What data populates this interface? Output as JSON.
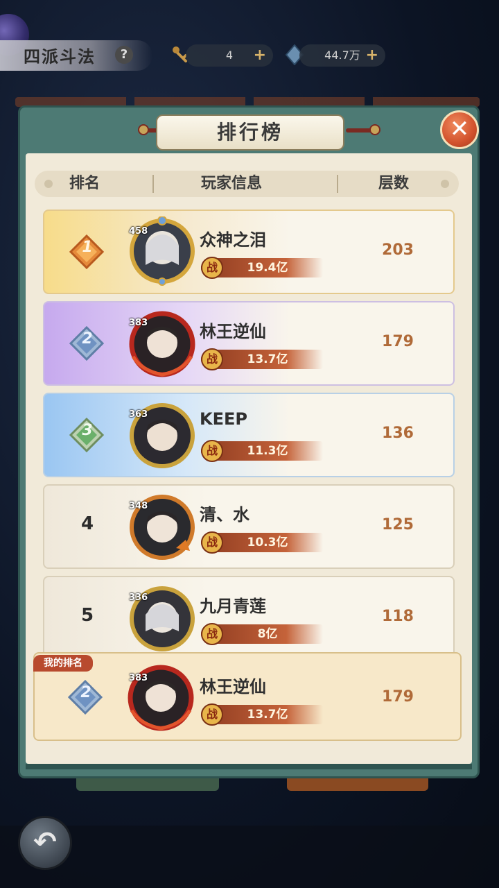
{
  "top": {
    "mode_title": "四派斗法",
    "help": "?",
    "resource1": {
      "value": "4",
      "plus": "+"
    },
    "resource2": {
      "value": "44.7万",
      "plus": "+"
    }
  },
  "panel": {
    "title": "排行榜",
    "close": "✕",
    "headers": {
      "rank": "排名",
      "player": "玩家信息",
      "floor": "层数"
    }
  },
  "rows": [
    {
      "rank": "1",
      "level": "458",
      "name": "众神之泪",
      "power_icon": "战",
      "power": "19.4亿",
      "floor": "203"
    },
    {
      "rank": "2",
      "level": "383",
      "name": "林王逆仙",
      "power_icon": "战",
      "power": "13.7亿",
      "floor": "179"
    },
    {
      "rank": "3",
      "level": "363",
      "name": "KEEP",
      "power_icon": "战",
      "power": "11.3亿",
      "floor": "136"
    },
    {
      "rank": "4",
      "level": "348",
      "name": "清、水",
      "power_icon": "战",
      "power": "10.3亿",
      "floor": "125"
    },
    {
      "rank": "5",
      "level": "336",
      "name": "九月青莲",
      "power_icon": "战",
      "power": "8亿",
      "floor": "118"
    }
  ],
  "my_rank": {
    "tag": "我的排名",
    "rank": "2",
    "level": "383",
    "name": "林王逆仙",
    "power_icon": "战",
    "power": "13.7亿",
    "floor": "179"
  },
  "back": "↶",
  "colors": {
    "gold": "#f7dc8a",
    "purple": "#c6a9ee",
    "blue": "#9ac6f2",
    "accent": "#d2522d"
  }
}
